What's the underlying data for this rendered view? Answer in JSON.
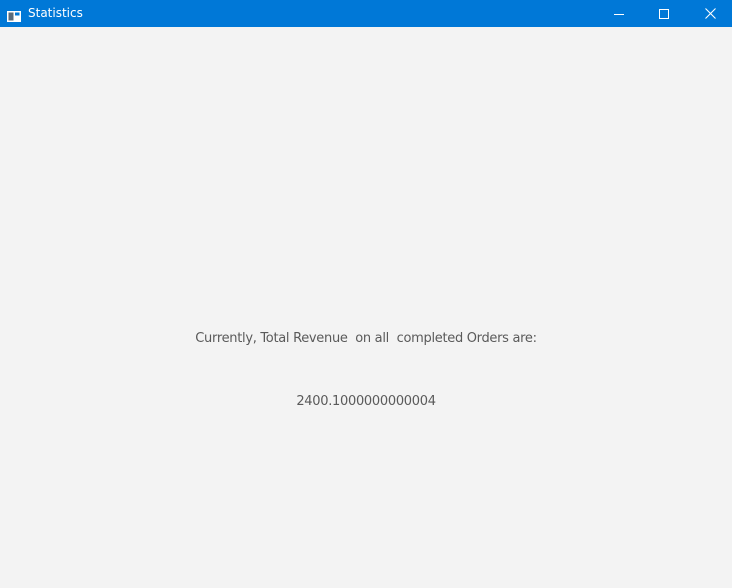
{
  "window": {
    "title": "Statistics",
    "icon": "app-window-icon",
    "controls": {
      "minimize_icon": "minimize-icon",
      "maximize_icon": "maximize-icon",
      "close_icon": "close-icon"
    },
    "accent_color": "#0078d7",
    "background_color": "#f3f3f3"
  },
  "content": {
    "revenue_label": "Currently, Total Revenue  on all  completed Orders are:",
    "revenue_value": "2400.1000000000004"
  }
}
